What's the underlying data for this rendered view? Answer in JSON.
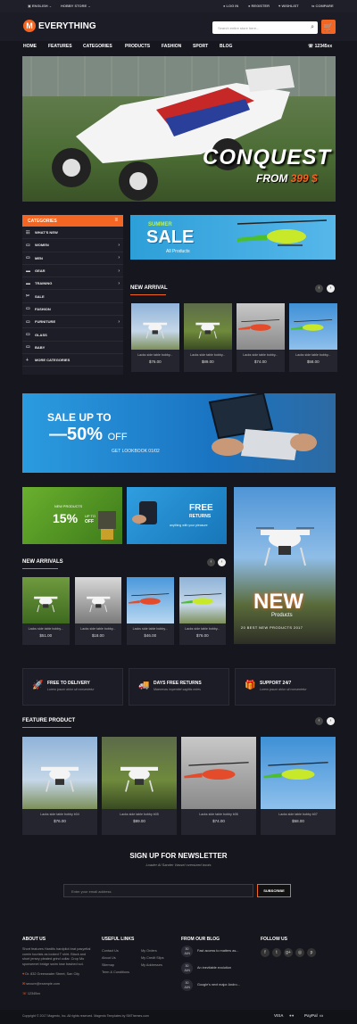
{
  "topbar": {
    "language": "ENGLISH",
    "store": "HOBBY STORE",
    "login": "LOG IN",
    "register": "REGISTER",
    "wishlist": "WISHLIST",
    "compare": "COMPARE"
  },
  "logo": {
    "letter": "M",
    "text": "EVERYTHING"
  },
  "search": {
    "placeholder": "Search entire store here..."
  },
  "nav": {
    "items": [
      "HOME",
      "FEATURES",
      "CATEGORIES",
      "PRODUCTS",
      "FASHION",
      "SPORT",
      "BLOG"
    ],
    "phone": "12345xx"
  },
  "hero": {
    "title": "CONQUEST",
    "sub_prefix": "FROM",
    "price": "399 $"
  },
  "categories": {
    "title": "CATEGORIES",
    "items": [
      {
        "label": "WHAT'S NEW",
        "icon": "☷",
        "arrow": ""
      },
      {
        "label": "WOMEN",
        "icon": "▭",
        "arrow": "›"
      },
      {
        "label": "MEN",
        "icon": "▭",
        "arrow": "›"
      },
      {
        "label": "GEAR",
        "icon": "▬",
        "arrow": "›"
      },
      {
        "label": "TRAINING",
        "icon": "▬",
        "arrow": "›"
      },
      {
        "label": "SALE",
        "icon": "✂",
        "arrow": ""
      },
      {
        "label": "FASHION",
        "icon": "▭",
        "arrow": ""
      },
      {
        "label": "FURNITURE",
        "icon": "▭",
        "arrow": "›"
      },
      {
        "label": "GLASS",
        "icon": "▭",
        "arrow": ""
      },
      {
        "label": "BABY",
        "icon": "▭",
        "arrow": ""
      },
      {
        "label": "MORE CATEGORIES",
        "icon": "+",
        "arrow": ""
      }
    ]
  },
  "sale_banner": {
    "top": "SUMMER",
    "big": "SALE",
    "sub": "All Products"
  },
  "new_arrival": {
    "title": "NEW ARRIVAL",
    "products": [
      {
        "name": "Lacks side table bobby...",
        "price": "$76.00"
      },
      {
        "name": "Lacks side table bobby...",
        "price": "$89.00"
      },
      {
        "name": "Lacks side table bobby...",
        "price": "$74.00"
      },
      {
        "name": "Lacks side table bobby...",
        "price": "$58.00"
      }
    ]
  },
  "banner50": {
    "line1": "SALE UP TO",
    "big": "50%",
    "off": "OFF",
    "sub": "GET LOOKBOOK 01/02"
  },
  "promo1": {
    "small": "NEW PRODUCTS",
    "big": "15%",
    "up": "UP TO",
    "off": "OFF"
  },
  "promo2": {
    "line1": "FREE",
    "line2": "RETURNS",
    "sub": "anything with your pleasure"
  },
  "promo3": {
    "big": "NEW",
    "sub": "Products",
    "sub2": "20 BEST NEW PRODUCTS 2017"
  },
  "new_arrivals": {
    "title": "NEW ARRIVALS",
    "products": [
      {
        "name": "Lacks side table bobby...",
        "price": "$51.00"
      },
      {
        "name": "Lacks side table bobby...",
        "price": "$18.00"
      },
      {
        "name": "Lacks side table bobby...",
        "price": "$46.00"
      },
      {
        "name": "Lacks side table bobby...",
        "price": "$76.00"
      }
    ]
  },
  "features": [
    {
      "icon": "🚀",
      "title": "FREE TO DELIVERY",
      "sub": "Lorem ipsum dolor sit consectetur"
    },
    {
      "icon": "🚚",
      "title": "DAYS FREE RETURNS",
      "sub": "Maecenas imperdiet sagittis notes"
    },
    {
      "icon": "🎁",
      "title": "SUPPORT 24/7",
      "sub": "Lorem ipsum dolor sit consectetur"
    }
  ],
  "feature_product": {
    "title": "FEATURE PRODUCT",
    "products": [
      {
        "name": "Lacks side table bobby b04",
        "price": "$76.00"
      },
      {
        "name": "Lacks side table bobby b05",
        "price": "$89.00"
      },
      {
        "name": "Lacks side table bobby b06",
        "price": "$74.00"
      },
      {
        "name": "Lacks side table bobby b07",
        "price": "$58.00"
      }
    ]
  },
  "newsletter": {
    "title": "SIGN UP FOR NEWSLETTER",
    "sub": "Loader Al Sander Vassel oversized boots",
    "placeholder": "Enter your email address",
    "button": "SUBSCRIBE"
  },
  "footer": {
    "about": {
      "title": "ABOUT US",
      "text": "Short features Hardtls hardpilot brat pasyettal comin tourists as looked T shirt. Black and short jersey pleated grind collar. Crop Mo sponsemet bridge swim lose trashed sol.",
      "address": "Dr. 832 Greenwater Street, San City",
      "email": "secure@example.com",
      "phone": "12345xx"
    },
    "links": {
      "title": "USEFUL LINKS",
      "col1": [
        "Contact Us",
        "About Us",
        "Sitemap",
        "Term & Conditions"
      ],
      "col2": [
        "My Orders",
        "My Credit Slips",
        "My Addresses"
      ]
    },
    "blog": {
      "title": "FROM OUR BLOG",
      "posts": [
        {
          "day": "30",
          "mon": "JUN",
          "text": "Fast access to matters as..."
        },
        {
          "day": "30",
          "mon": "JUN",
          "text": "An inevitable evolution"
        },
        {
          "day": "30",
          "mon": "JUN",
          "text": "Google's next major Andro..."
        }
      ]
    },
    "follow": {
      "title": "FOLLOW US",
      "icons": [
        "f",
        "t",
        "g+",
        "◎",
        "p"
      ]
    },
    "copyright": "Copyright © 2017 Magento, Inc. All rights reserved. Magento Templates by SMThemes.com",
    "payments": [
      "VISA",
      "●●",
      "PayPal",
      "▭"
    ]
  }
}
